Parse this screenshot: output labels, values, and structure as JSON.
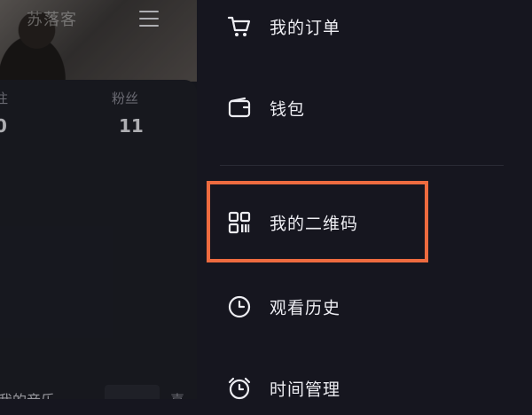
{
  "profile": {
    "cover_name": "苏落客",
    "stats": [
      {
        "label": "注",
        "value": "0"
      },
      {
        "label": "粉丝",
        "value": "11"
      }
    ],
    "music_label": "我的音乐",
    "music_right": "喜"
  },
  "drawer": {
    "items": [
      {
        "label": "我的订单",
        "icon": "cart-icon"
      },
      {
        "label": "钱包",
        "icon": "wallet-icon"
      },
      {
        "label": "我的二维码",
        "icon": "qr-code-icon",
        "highlighted": true
      },
      {
        "label": "观看历史",
        "icon": "clock-icon"
      },
      {
        "label": "时间管理",
        "icon": "alarm-icon"
      }
    ]
  },
  "colors": {
    "background": "#16161f",
    "highlight": "#ee6b3f"
  }
}
